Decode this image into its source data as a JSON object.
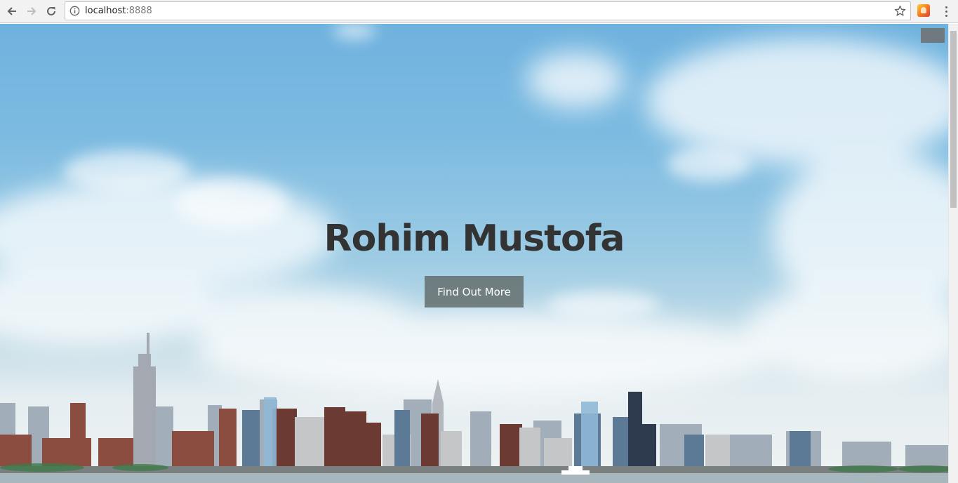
{
  "browser": {
    "url_host": "localhost",
    "url_port": ":8888",
    "icons": {
      "back": "arrow-left-icon",
      "forward": "arrow-right-icon",
      "reload": "reload-icon",
      "site_info": "info-icon",
      "bookmark": "star-icon",
      "extension": "extension-icon",
      "menu": "kebab-menu-icon"
    }
  },
  "page": {
    "hero_title": "Rohim Mustofa",
    "hero_button_label": "Find Out More",
    "colors": {
      "title": "#333333",
      "button_bg": "#646e6e",
      "button_text": "#ffffff",
      "sky_top": "#6fb2de",
      "sky_bottom": "#eef2f3"
    }
  }
}
